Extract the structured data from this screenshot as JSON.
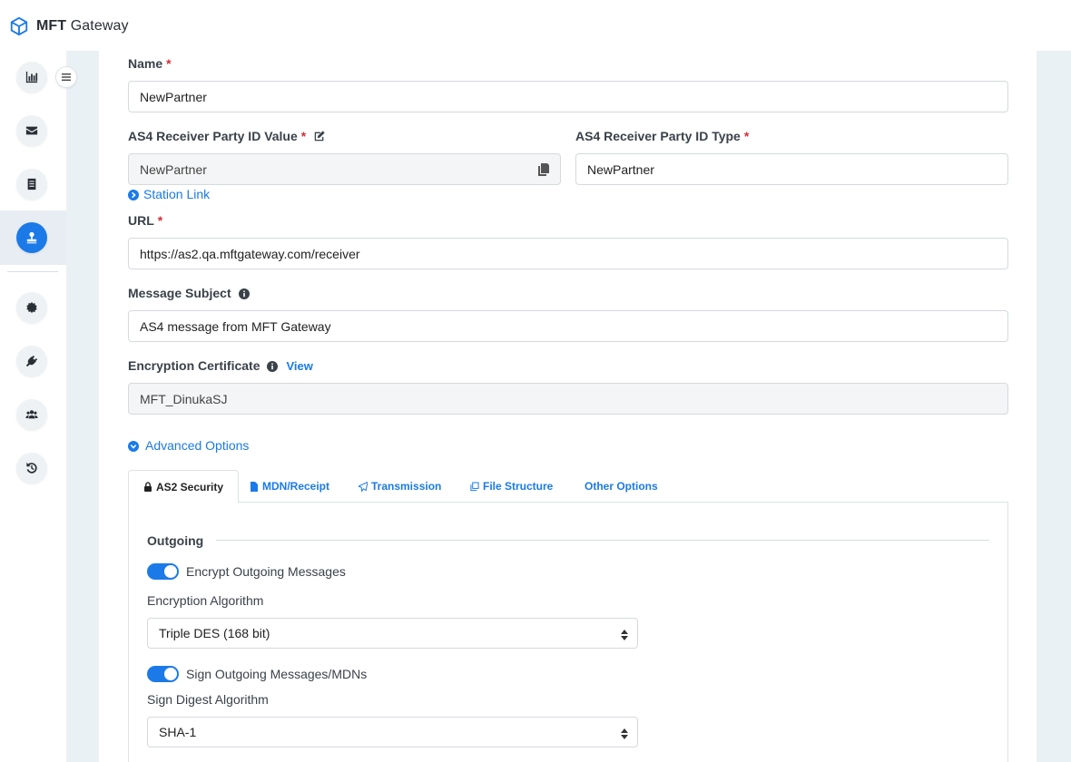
{
  "brand": {
    "bold": "MFT",
    "rest": " Gateway"
  },
  "form": {
    "name": {
      "label": "Name",
      "required": "*",
      "value": "NewPartner"
    },
    "party_id_value": {
      "label": "AS4 Receiver Party ID Value",
      "required": "*",
      "value": "NewPartner"
    },
    "party_id_type": {
      "label": "AS4 Receiver Party ID Type",
      "required": "*",
      "value": "NewPartner"
    },
    "station_link": "Station Link",
    "url": {
      "label": "URL",
      "required": "*",
      "value": "https://as2.qa.mftgateway.com/receiver"
    },
    "message_subject": {
      "label": "Message Subject",
      "value": "AS4 message from MFT Gateway"
    },
    "encryption_certificate": {
      "label": "Encryption Certificate",
      "view": "View",
      "value": "MFT_DinukaSJ"
    },
    "advanced_options": "Advanced Options"
  },
  "tabs": [
    {
      "label": "AS2 Security",
      "icon": "lock-icon",
      "active": true
    },
    {
      "label": "MDN/Receipt",
      "icon": "file-icon"
    },
    {
      "label": "Transmission",
      "icon": "paper-plane-icon"
    },
    {
      "label": "File Structure",
      "icon": "copy-icon"
    },
    {
      "label": "Other Options",
      "icon": ""
    }
  ],
  "security": {
    "section": "Outgoing",
    "encrypt_toggle": {
      "label": "Encrypt Outgoing Messages",
      "on": true
    },
    "encryption_algorithm": {
      "label": "Encryption Algorithm",
      "value": "Triple DES (168 bit)"
    },
    "sign_toggle": {
      "label": "Sign Outgoing Messages/MDNs",
      "on": true
    },
    "sign_digest": {
      "label": "Sign Digest Algorithm",
      "value": "SHA-1"
    }
  },
  "colors": {
    "accent": "#1b7ae8",
    "required": "#d32f3a",
    "background": "#eaf1f5"
  }
}
